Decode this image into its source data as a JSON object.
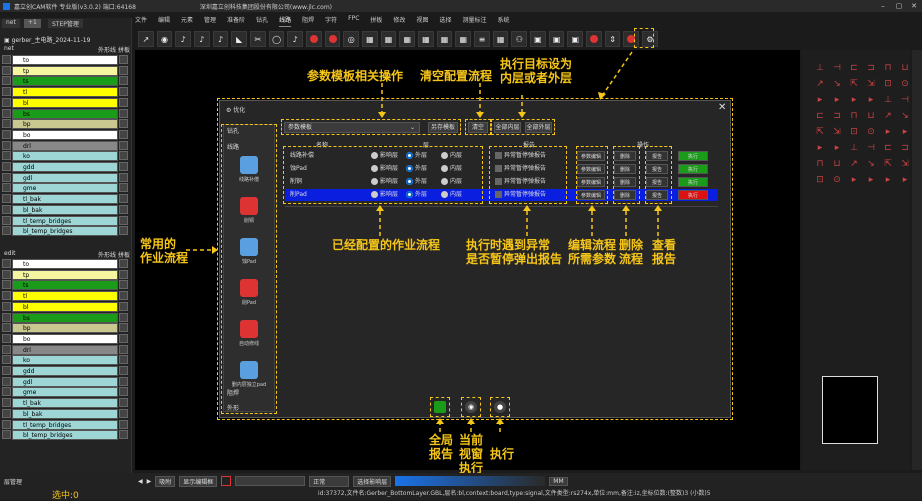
{
  "window": {
    "title": "嘉立创CAM软件 专业版(v3.0.2) 端口:64168",
    "company": "深圳嘉立创科技集团股份有限公司(www.jlc.com)"
  },
  "menu": [
    "文件",
    "编辑",
    "元素",
    "管理",
    "准备阶",
    "钻孔",
    "线路",
    "阻焊",
    "字符",
    "FPC",
    "拼板",
    "修改",
    "视图",
    "选择",
    "测量标注",
    "系统"
  ],
  "left_panel": {
    "tabs": [
      "net",
      "+1",
      "STEP管理"
    ],
    "job": "gerber_主电路_2024-11-19",
    "net_header": {
      "name": "net",
      "outer": "外形线",
      "split": "拼板"
    },
    "net_layers": [
      {
        "name": "to",
        "color": "#ffffff"
      },
      {
        "name": "tp",
        "color": "#f6f6a0"
      },
      {
        "name": "ts",
        "color": "#1a9b1a"
      },
      {
        "name": "tl",
        "color": "#ffff00"
      },
      {
        "name": "bl",
        "color": "#ffff00"
      },
      {
        "name": "bs",
        "color": "#1a9b1a"
      },
      {
        "name": "bp",
        "color": "#c8c890"
      },
      {
        "name": "bo",
        "color": "#ffffff"
      },
      {
        "name": "drl",
        "color": "#888888"
      },
      {
        "name": "ko",
        "color": "#9ed6d6"
      },
      {
        "name": "gdd",
        "color": "#9ed6d6"
      },
      {
        "name": "gdl",
        "color": "#9ed6d6"
      },
      {
        "name": "gme",
        "color": "#9ed6d6"
      },
      {
        "name": "tl_bak",
        "color": "#9ed6d6"
      },
      {
        "name": "bl_bak",
        "color": "#9ed6d6"
      },
      {
        "name": "tl_temp_bridges",
        "color": "#9ed6d6"
      },
      {
        "name": "bl_temp_bridges",
        "color": "#9ed6d6"
      }
    ],
    "edit_header": {
      "name": "edit",
      "outer": "外形线",
      "split": "拼板"
    },
    "edit_layers": [
      {
        "name": "to",
        "color": "#ffffff"
      },
      {
        "name": "tp",
        "color": "#f6f6a0"
      },
      {
        "name": "ts",
        "color": "#1a9b1a"
      },
      {
        "name": "tl",
        "color": "#ffff00"
      },
      {
        "name": "bl",
        "color": "#ffff00"
      },
      {
        "name": "bs",
        "color": "#1a9b1a"
      },
      {
        "name": "bp",
        "color": "#c8c890"
      },
      {
        "name": "bo",
        "color": "#ffffff"
      },
      {
        "name": "drl",
        "color": "#888888"
      },
      {
        "name": "ko",
        "color": "#9ed6d6"
      },
      {
        "name": "gdd",
        "color": "#9ed6d6"
      },
      {
        "name": "gdl",
        "color": "#9ed6d6"
      },
      {
        "name": "gme",
        "color": "#9ed6d6"
      },
      {
        "name": "tl_bak",
        "color": "#9ed6d6"
      },
      {
        "name": "bl_bak",
        "color": "#9ed6d6"
      },
      {
        "name": "tl_temp_bridges",
        "color": "#9ed6d6"
      },
      {
        "name": "bl_temp_bridges",
        "color": "#9ed6d6"
      }
    ],
    "layer_mgmt": "层管理",
    "selected": "选中:0"
  },
  "dialog": {
    "title": "优化",
    "categories": [
      "钻孔",
      "线路",
      "阻焊",
      "外形"
    ],
    "workflows": [
      {
        "label": "线路补偿",
        "color": "#5aa0e0"
      },
      {
        "label": "削铜",
        "color": "#d33"
      },
      {
        "label": "蚀Pad",
        "color": "#5aa0e0"
      },
      {
        "label": "削Pad",
        "color": "#d33"
      },
      {
        "label": "自动修线",
        "color": "#d33"
      },
      {
        "label": "删内层独立pad",
        "color": "#5aa0e0"
      }
    ],
    "template_select": "参数模板",
    "save_template": "另存模板",
    "clear": "清空",
    "all_inner": "全部内层",
    "all_outer": "全部外层",
    "headers": {
      "name": "名称",
      "layer": "层",
      "report": "报告",
      "ops": "操作"
    },
    "rows": [
      {
        "name": "线路补偿",
        "radios": [
          "影响层",
          "外层",
          "内层"
        ],
        "sel": 1,
        "report": "异常暂停弹报告",
        "edit": "参数编辑",
        "del": "删除",
        "rep": "报告",
        "exec": "执行",
        "exec_color": "#1a9b1a",
        "highlight": false
      },
      {
        "name": "蚀Pad",
        "radios": [
          "影响层",
          "外层",
          "内层"
        ],
        "sel": 1,
        "report": "异常暂停弹报告",
        "edit": "参数编辑",
        "del": "删除",
        "rep": "报告",
        "exec": "执行",
        "exec_color": "#1a9b1a",
        "highlight": false
      },
      {
        "name": "削铜",
        "radios": [
          "影响层",
          "外层",
          "内层"
        ],
        "sel": 1,
        "report": "异常暂停弹报告",
        "edit": "参数编辑",
        "del": "删除",
        "rep": "报告",
        "exec": "执行",
        "exec_color": "#1a9b1a",
        "highlight": false
      },
      {
        "name": "削Pad",
        "radios": [
          "影响层",
          "外层",
          "内层"
        ],
        "sel": 1,
        "report": "异常暂停弹报告",
        "edit": "参数编辑",
        "del": "删除",
        "rep": "报告",
        "exec": "执行",
        "exec_color": "#d11",
        "highlight": true
      }
    ]
  },
  "annotations": {
    "params": "参数模板相关操作",
    "clear": "清空配置流程",
    "target1": "执行目标设为",
    "target2": "内层或者外层",
    "common1": "常用的",
    "common2": "作业流程",
    "configured": "已经配置的作业流程",
    "exc1": "执行时遇到异常",
    "exc2": "是否暂停弹出报告",
    "edit1": "编辑流程",
    "edit2": "所需参数",
    "del1": "删除",
    "del2": "流程",
    "view1": "查看",
    "view2": "报告",
    "global1": "全局",
    "global2": "报告",
    "cur1": "当前",
    "cur2": "视窗",
    "cur3": "执行",
    "exec": "执行"
  },
  "bottom": {
    "snap": "吸附",
    "mode": "显示编辑框",
    "line": "正常",
    "unit": "MM",
    "select_all": "选择影响层"
  },
  "status": "id:37372,文件名:Gerber_BottomLayer.GBL,层名:bl,context:board,type:signal,文件类型:rs274x,单位:mm,备注:iz,坐标位数:(整数)3 (小数)5"
}
